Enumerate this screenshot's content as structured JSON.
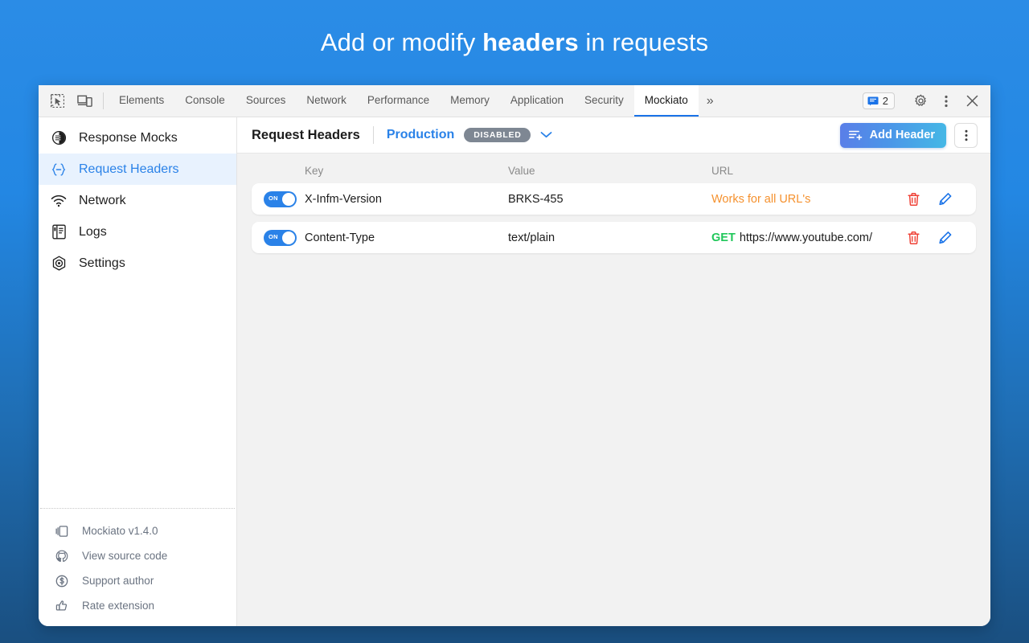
{
  "promo": {
    "text_before": "Add or modify ",
    "text_bold": "headers",
    "text_after": " in requests",
    "bg_top_color": "#2b8ce6",
    "bg_bottom_color": "#1a4f80"
  },
  "devtools": {
    "left_icons": [
      {
        "name": "inspect-element-icon",
        "label": "Inspect element"
      },
      {
        "name": "device-toolbar-icon",
        "label": "Toggle device toolbar"
      }
    ],
    "tabs": [
      {
        "label": "Elements",
        "active": false
      },
      {
        "label": "Console",
        "active": false
      },
      {
        "label": "Sources",
        "active": false
      },
      {
        "label": "Network",
        "active": false
      },
      {
        "label": "Performance",
        "active": false
      },
      {
        "label": "Memory",
        "active": false
      },
      {
        "label": "Application",
        "active": false
      },
      {
        "label": "Security",
        "active": false
      },
      {
        "label": "Mockiato",
        "active": true
      }
    ],
    "more_tabs_label": "»",
    "message_count": "2",
    "right_icons": [
      {
        "name": "settings-gear-icon"
      },
      {
        "name": "more-options-icon"
      },
      {
        "name": "close-devtools-icon"
      }
    ],
    "active_tab_accent": "#1a73e8"
  },
  "sidebar": {
    "items": [
      {
        "label": "Response Mocks",
        "icon": "response-mocks-icon",
        "active": false
      },
      {
        "label": "Request Headers",
        "icon": "request-headers-icon",
        "active": true
      },
      {
        "label": "Network",
        "icon": "network-wifi-icon",
        "active": false
      },
      {
        "label": "Logs",
        "icon": "logs-book-icon",
        "active": false
      },
      {
        "label": "Settings",
        "icon": "settings-hex-icon",
        "active": false
      }
    ],
    "active_color": "#2a82e8",
    "active_bg": "#e8f2fe",
    "footer": [
      {
        "label": "Mockiato v1.4.0",
        "icon": "app-version-icon"
      },
      {
        "label": "View source code",
        "icon": "github-icon"
      },
      {
        "label": "Support author",
        "icon": "dollar-circle-icon"
      },
      {
        "label": "Rate extension",
        "icon": "thumbs-up-icon"
      }
    ]
  },
  "main": {
    "title": "Request Headers",
    "environment": "Production",
    "environment_badge": "DISABLED",
    "badge_color": "#7e8793",
    "add_button_label": "Add Header",
    "columns": {
      "key": "Key",
      "value": "Value",
      "url": "URL"
    },
    "rows": [
      {
        "enabled": true,
        "toggle_state": "ON",
        "key": "X-Infm-Version",
        "value": "BRKS-455",
        "url_kind": "all",
        "url_all_text": "Works for all URL's",
        "url_method": "",
        "url_text": ""
      },
      {
        "enabled": true,
        "toggle_state": "ON",
        "key": "Content-Type",
        "value": "text/plain",
        "url_kind": "method",
        "url_all_text": "",
        "url_method": "GET",
        "url_text": "https://www.youtube.com/"
      }
    ],
    "row_actions": [
      {
        "name": "delete-row-button",
        "color": "#ef4136"
      },
      {
        "name": "edit-row-button",
        "color": "#1a73e8"
      }
    ]
  }
}
